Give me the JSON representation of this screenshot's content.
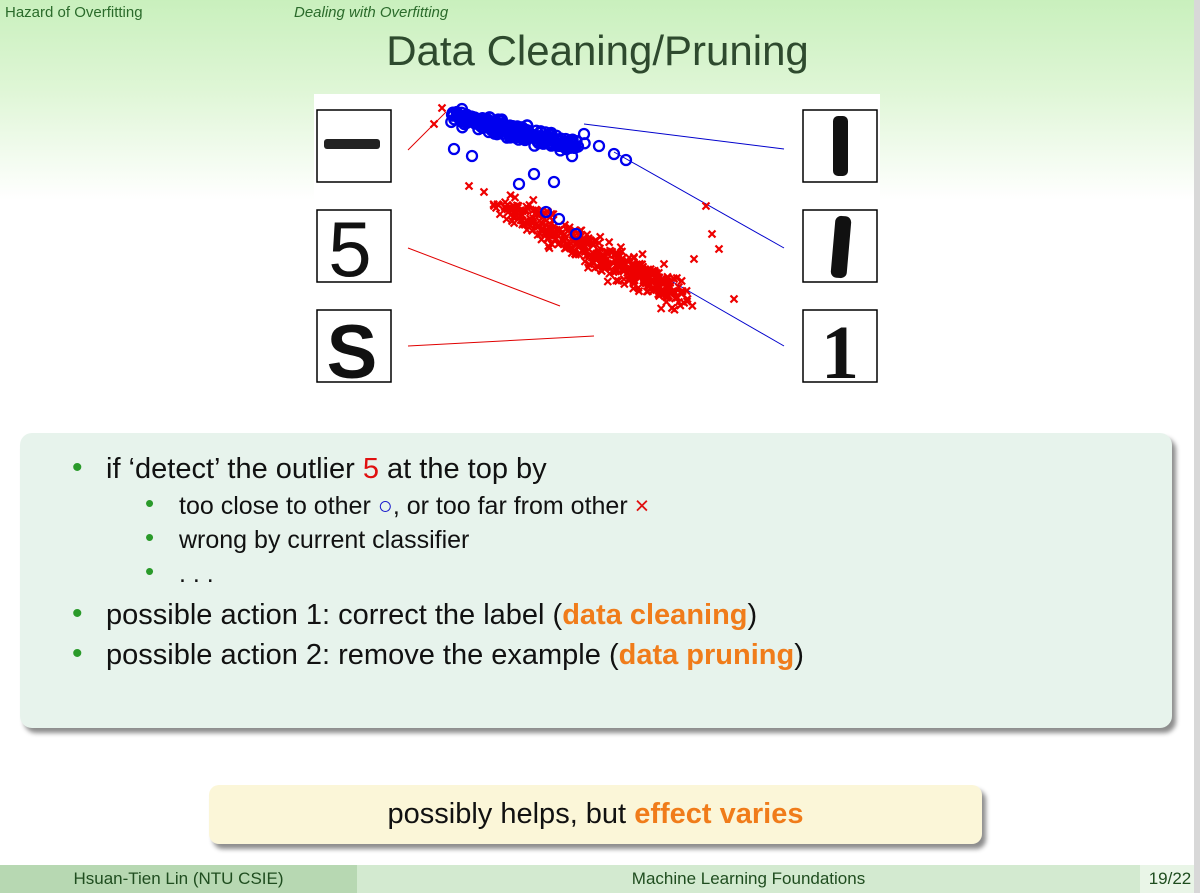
{
  "nav": {
    "section": "Hazard of Overfitting",
    "subsection": "Dealing with Overfitting"
  },
  "slide": {
    "title": "Data Cleaning/Pruning"
  },
  "figure": {
    "digits_left": [
      "−",
      "5",
      "S"
    ],
    "digits_right": [
      "l",
      "l",
      "1"
    ],
    "colors": {
      "circle": "#0000ee",
      "cross": "#ee0000"
    }
  },
  "bullets": {
    "b1_pre": "if ‘detect’ the outlier ",
    "b1_hl": "5",
    "b1_post": " at the top by",
    "s1_pre": "too close to other ",
    "s1_circle": "○",
    "s1_mid": ", or too far from other ",
    "s1_cross": "×",
    "s2": "wrong by current classifier",
    "s3": ". . .",
    "b2_pre": "possible action 1: correct the label (",
    "b2_hl": "data cleaning",
    "b2_post": ")",
    "b3_pre": "possible action 2: remove the example (",
    "b3_hl": "data pruning",
    "b3_post": ")"
  },
  "note": {
    "pre": "possibly helps, but ",
    "hl": "effect varies"
  },
  "footer": {
    "author": "Hsuan-Tien Lin  (NTU CSIE)",
    "course": "Machine Learning Foundations",
    "page": "19/22"
  }
}
